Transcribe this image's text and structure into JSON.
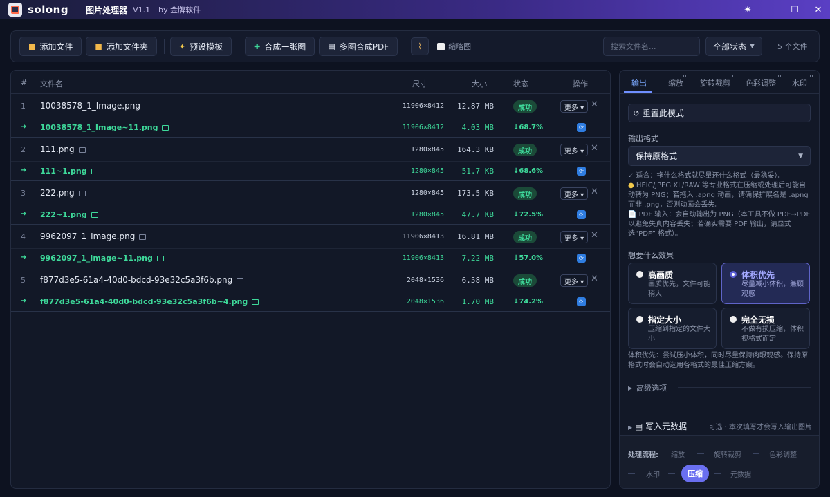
{
  "titlebar": {
    "app_name": "solong",
    "subtitle": "图片处理器",
    "version": "V1.1",
    "by": "by 金牌软件",
    "controls": [
      "✷",
      "—",
      "☐",
      "✕"
    ]
  },
  "toolbar": {
    "add_file": "添加文件",
    "add_folder": "添加文件夹",
    "preset": "预设模板",
    "merge_one": "合成一张图",
    "merge_pdf": "多图合成PDF",
    "thumbnail": "缩略图",
    "search_placeholder": "搜索文件名...",
    "status_filter": "全部状态",
    "file_count": "5 个文件"
  },
  "table": {
    "headers": {
      "idx": "#",
      "name": "文件名",
      "dim": "尺寸",
      "size": "大小",
      "status": "状态",
      "action": "操作"
    },
    "status_label": "成功",
    "more_label": "更多 ▾",
    "files": [
      {
        "idx": "1",
        "name": "10038578_1_Image.png",
        "dim": "11906×8412",
        "size": "12.87 MB",
        "out_name": "10038578_1_Image~11.png",
        "out_dim": "11906×8412",
        "out_size": "4.03 MB",
        "ratio": "↓68.7%"
      },
      {
        "idx": "2",
        "name": "111.png",
        "dim": "1280×845",
        "size": "164.3 KB",
        "out_name": "111~1.png",
        "out_dim": "1280×845",
        "out_size": "51.7 KB",
        "ratio": "↓68.6%"
      },
      {
        "idx": "3",
        "name": "222.png",
        "dim": "1280×845",
        "size": "173.5 KB",
        "out_name": "222~1.png",
        "out_dim": "1280×845",
        "out_size": "47.7 KB",
        "ratio": "↓72.5%"
      },
      {
        "idx": "4",
        "name": "9962097_1_Image.png",
        "dim": "11906×8413",
        "size": "16.81 MB",
        "out_name": "9962097_1_Image~11.png",
        "out_dim": "11906×8413",
        "out_size": "7.22 MB",
        "ratio": "↓57.0%"
      },
      {
        "idx": "5",
        "name": "f877d3e5-61a4-40d0-bdcd-93e32c5a3f6b.png",
        "dim": "2048×1536",
        "size": "6.58 MB",
        "out_name": "f877d3e5-61a4-40d0-bdcd-93e32c5a3f6b~4.png",
        "out_dim": "2048×1536",
        "out_size": "1.70 MB",
        "ratio": "↓74.2%"
      }
    ]
  },
  "panel": {
    "tabs": [
      "输出",
      "缩放",
      "旋转裁剪",
      "色彩调整",
      "水印"
    ],
    "reset": "↺ 重置此模式",
    "output_format_label": "输出格式",
    "output_format_value": "保持原格式",
    "note_1": "✓ 适合：拖什么格式就尽量还什么格式（最稳妥）。",
    "note_2": "HEIC/JPEG XL/RAW 等专业格式在压缩或处理后可能自动转为 PNG；若拖入 .apng 动画，请确保扩展名是 .apng 而非 .png，否则动画会丢失。",
    "note_3": "📄 PDF 输入：会自动输出为 PNG（本工具不做 PDF→PDF 以避免失真内容丢失；若确实需要 PDF 输出，请显式选“PDF” 格式）。",
    "effect_label": "想要什么效果",
    "options": [
      {
        "title": "高画质",
        "desc": "画质优先，文件可能稍大"
      },
      {
        "title": "体积优先",
        "desc": "尽量减小体积，兼顾观感"
      },
      {
        "title": "指定大小",
        "desc": "压缩到指定的文件大小"
      },
      {
        "title": "完全无损",
        "desc": "不做有损压缩，体积视格式而定"
      }
    ],
    "effect_note": "体积优先：尝试压小体积，同时尽量保持肉眼观感。保持原格式时会自动选用各格式的最佳压缩方案。",
    "advanced": "高级选项",
    "metadata_title": "写入元数据",
    "metadata_note": "可选 · 本次填写才会写入输出图片",
    "flow_label": "处理流程:",
    "flow_steps": [
      "缩放",
      "旋转裁剪",
      "色彩调整",
      "水印",
      "压缩",
      "元数据"
    ]
  },
  "colors": {
    "accent": "#6a6ff0",
    "success": "#3ed99a",
    "title_gradient_end": "#5a3fc4"
  }
}
